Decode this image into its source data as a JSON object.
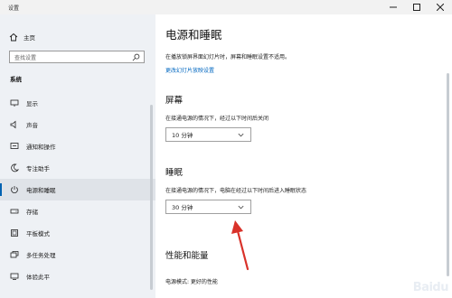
{
  "app": {
    "title": "设置"
  },
  "window_controls": {
    "minimize": "—",
    "maximize": "□",
    "close": "✕"
  },
  "sidebar": {
    "home": "主页",
    "search_placeholder": "查找设置",
    "section": "系统",
    "items": [
      {
        "label": "显示",
        "icon": "display-icon"
      },
      {
        "label": "声音",
        "icon": "speaker-icon"
      },
      {
        "label": "通知和操作",
        "icon": "notifications-icon"
      },
      {
        "label": "专注助手",
        "icon": "moon-icon"
      },
      {
        "label": "电源和睡眠",
        "icon": "power-icon",
        "active": true
      },
      {
        "label": "存储",
        "icon": "storage-icon"
      },
      {
        "label": "平板模式",
        "icon": "tablet-icon"
      },
      {
        "label": "多任务处理",
        "icon": "multitask-icon"
      },
      {
        "label": "体验此平",
        "icon": "project-icon"
      }
    ]
  },
  "main": {
    "title": "电源和睡眠",
    "description": "在播放锁屏界面幻灯片时，屏幕和睡眠设置不适用。",
    "link": "更改幻灯片放映设置",
    "screen": {
      "heading": "屏幕",
      "label": "在接通电源的情况下，经过以下时间后关闭",
      "value": "10 分钟"
    },
    "sleep": {
      "heading": "睡眠",
      "label": "在接通电源的情况下，电脑在经过以下时间后进入睡眠状态",
      "value": "30 分钟"
    },
    "performance": {
      "heading": "性能和能量",
      "label": "电源模式: 更好的性能"
    }
  },
  "watermark": "Baidu",
  "colors": {
    "accent": "#0063b1",
    "link": "#0067c0",
    "arrow": "#d9322a"
  }
}
